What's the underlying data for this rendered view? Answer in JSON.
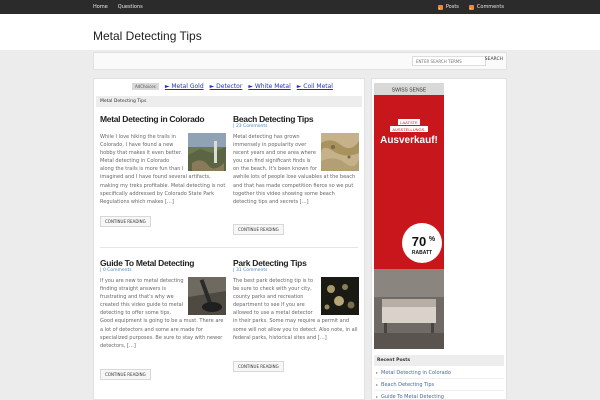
{
  "topnav": {
    "left": [
      "Home",
      "Questions"
    ],
    "right": [
      {
        "label": "Posts",
        "icon": "rss-icon"
      },
      {
        "label": "Comments",
        "icon": "rss-icon"
      }
    ]
  },
  "site": {
    "title": "Metal Detecting Tips"
  },
  "search": {
    "placeholder": "ENTER SEARCH TERMS",
    "button": "SEARCH"
  },
  "ads": {
    "choices_label": "AdChoices",
    "links": [
      "► Metal Gold",
      "► Detector",
      "► White Metal",
      "► Coil Metal"
    ]
  },
  "breadcrumb": "Metal Detecting Tips",
  "posts": [
    {
      "title": "Metal Detecting in Colorado",
      "meta": "",
      "excerpt": "While I love hiking the trails in Colorado, I have found a new hobby that makes it even better. Metal detecting in Colorado along the trails is more fun than I imagined and I have found several artifacts, making my treks profitable. Metal detecting is not specifically addressed by Colorado State Park Regulations which makes […]",
      "more": "CONTINUE READING"
    },
    {
      "title": "Beach Detecting Tips",
      "meta": "| 23 Comments",
      "excerpt": "Metal detecting has grown immensely in popularity over recent years and one area where you can find significant finds is on the beach.  It's been known for awhile lots of people lose valuables at the beach and that has made competition fierce so we put together this video showing some beach detecting tips and secrets […]",
      "more": "CONTINUE READING"
    },
    {
      "title": "Guide To Metal Detecting",
      "meta": "| 0 Comments",
      "excerpt": "If you are new to metal detecting finding straight answers is frustrating and that's why we created this video guide to metal detecting to offer some tips. Good equipment is going to be a must. There are a lot of detectors and some are made for specialized purposes. Be sure to stay with newer detectors, […]",
      "more": "CONTINUE READING"
    },
    {
      "title": "Park Detecting Tips",
      "meta": "| 31 Comments",
      "excerpt": "The best park detecting tip is to be sure to check with your city, county parks and recreation department to see if you are allowed to use a metal detector in their parks.  Some may require a permit and some will not allow you to detect.  Also note, in all federal parks, historical sites and […]",
      "more": "CONTINUE READING"
    }
  ],
  "sidebar_ad": {
    "brand": "SWISS SENSE",
    "tag1": "LAATSTE",
    "tag2": "AUSSTELLUNGS-",
    "headline": "Ausverkauf!",
    "percent": "70",
    "pct_sign": "%",
    "discount": "RABATT"
  },
  "recent": {
    "heading": "Recent Posts",
    "items": [
      "Metal Detecting in Colorado",
      "Beach Detecting Tips",
      "Guide To Metal Detecting"
    ]
  },
  "colors": {
    "topbar": "#2b2b2b",
    "link": "#4a86c5",
    "ad_red": "#c8161d"
  }
}
